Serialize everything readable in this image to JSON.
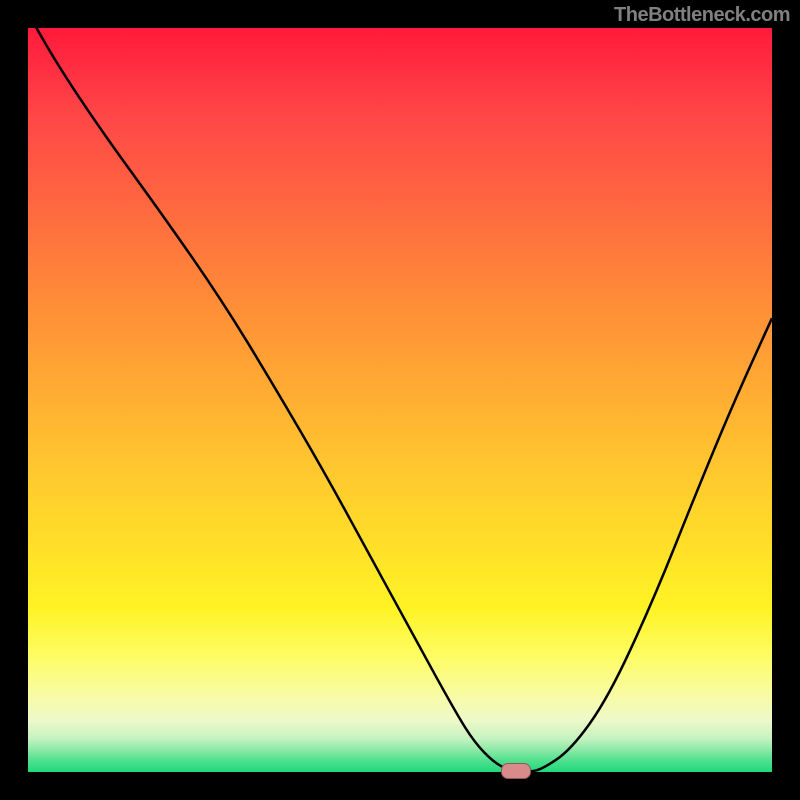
{
  "watermark": "TheBottleneck.com",
  "colors": {
    "frame": "#000000",
    "gradient_top": "#ff1a3a",
    "gradient_bottom": "#1ed97a",
    "curve": "#000000",
    "marker": "#d98b8b"
  },
  "chart_data": {
    "type": "line",
    "title": "",
    "xlabel": "",
    "ylabel": "",
    "xlim": [
      0,
      100
    ],
    "ylim": [
      0,
      100
    ],
    "x": [
      0,
      4,
      10,
      18,
      26,
      33,
      40,
      46,
      52,
      57.5,
      60,
      62.5,
      64.5,
      65.5,
      67,
      69,
      73,
      78,
      84,
      90,
      95,
      100
    ],
    "y": [
      102,
      95,
      86,
      75,
      63.5,
      52,
      40,
      29,
      18,
      8,
      4,
      1.4,
      0.3,
      0,
      0,
      0.3,
      3,
      10,
      23,
      38,
      50,
      61
    ],
    "marker": {
      "x": 65.5,
      "y": 0
    },
    "notes": "V-shaped bottleneck curve over vertical red→green gradient; minimum at ~65% on x-axis touching bottom (0%). Values are estimated from pixels; no axes or tick labels are shown in the source image."
  }
}
